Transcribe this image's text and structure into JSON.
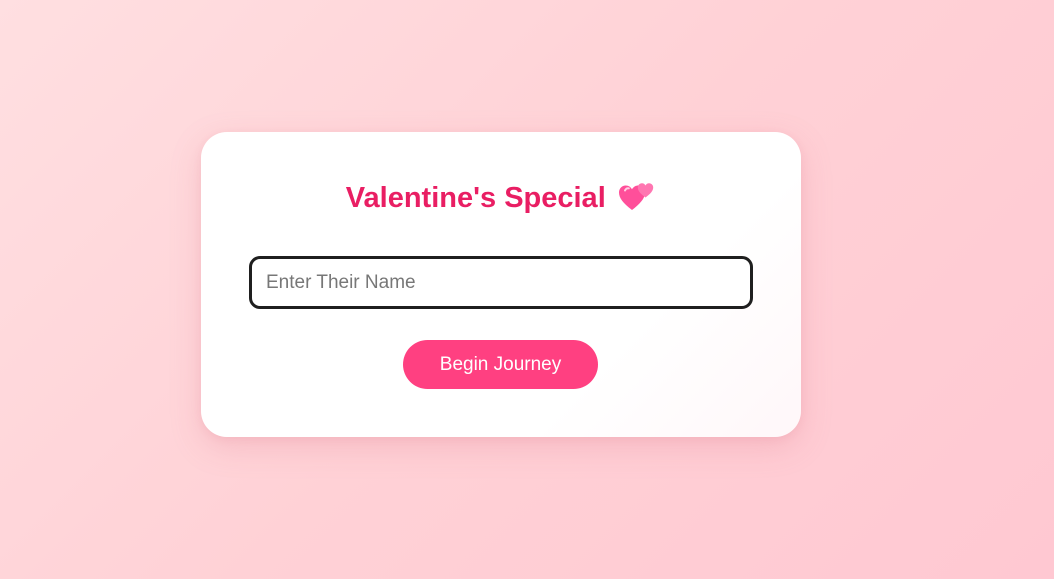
{
  "card": {
    "title": "Valentine's Special",
    "title_icon": "two-hearts-icon",
    "name_input": {
      "value": "",
      "placeholder": "Enter Their Name"
    },
    "begin_button_label": "Begin Journey"
  },
  "colors": {
    "title": "#e91e63",
    "button": "#ff4081",
    "background": "#ffd1d6"
  }
}
